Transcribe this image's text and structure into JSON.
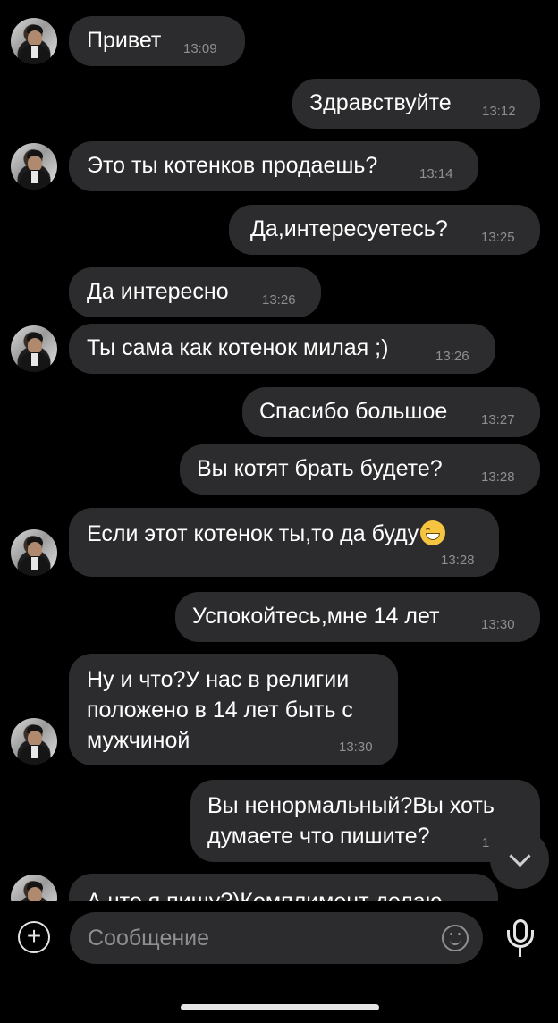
{
  "messages": [
    {
      "side": "in",
      "avatar": true,
      "text": "Привет",
      "time": "13:09"
    },
    {
      "side": "out",
      "text": "Здравствуйте",
      "time": "13:12"
    },
    {
      "side": "in",
      "avatar": true,
      "text": "Это ты котенков продаешь?",
      "time": "13:14"
    },
    {
      "side": "out",
      "text": "Да,интересуетесь?",
      "time": "13:25"
    },
    {
      "side": "in",
      "avatar": false,
      "text": "Да интересно",
      "time": "13:26"
    },
    {
      "side": "in",
      "avatar": true,
      "text": "Ты сама как котенок милая ;)",
      "time": "13:26"
    },
    {
      "side": "out",
      "text": "Спасибо большое",
      "time": "13:27"
    },
    {
      "side": "out",
      "text": "Вы котят брать будете?",
      "time": "13:28"
    },
    {
      "side": "in",
      "avatar": true,
      "text": "Если этот котенок ты,то да буду",
      "emoji": "grinning-face-emoji",
      "time": "13:28"
    },
    {
      "side": "out",
      "text": "Успокойтесь,мне 14 лет",
      "time": "13:30"
    },
    {
      "side": "in",
      "avatar": true,
      "lines": [
        "Ну и что?У нас в религии",
        "положено в 14 лет быть с",
        "мужчиной"
      ],
      "time": "13:30"
    },
    {
      "side": "out",
      "lines": [
        "Вы ненормальный?Вы хоть",
        "думаете что пишите?"
      ],
      "time": "1"
    },
    {
      "side": "in",
      "avatar": true,
      "text": "А что я пишу?)Комплимент делаю",
      "time": ""
    }
  ],
  "composer": {
    "placeholder": "Сообщение",
    "attach_icon": "plus-circle-icon",
    "emoji_icon": "smiley-icon",
    "voice_icon": "microphone-icon"
  },
  "scroll_down_icon": "chevron-down-icon",
  "colors": {
    "background": "#000000",
    "bubble": "#2c2c2e",
    "text": "#ffffff",
    "time": "#8e8e93"
  }
}
